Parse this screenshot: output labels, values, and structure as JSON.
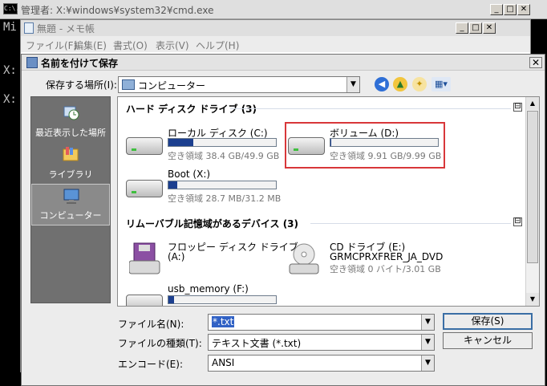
{
  "cmd": {
    "title": "管理者: X:¥windows¥system32¥cmd.exe",
    "icon_text": "C:\\.",
    "prompt_lines": [
      "Mi",
      "X:",
      "X:"
    ]
  },
  "notepad": {
    "title": "無題 - メモ帳",
    "menu": [
      "ファイル(F)",
      "編集(E)",
      "書式(O)",
      "表示(V)",
      "ヘルプ(H)"
    ]
  },
  "dialog": {
    "title": "名前を付けて保存",
    "save_in_label": "保存する場所(I):",
    "save_in_value": "コンピューター",
    "places": [
      {
        "label": "最近表示した場所",
        "icon": "recent-places-icon"
      },
      {
        "label": "ライブラリ",
        "icon": "libraries-icon"
      },
      {
        "label": "コンピューター",
        "icon": "computer-icon"
      }
    ],
    "groups": [
      {
        "header": "ハード ディスク ドライブ (3)"
      },
      {
        "header": "リムーバブル記憶域があるデバイス (3)"
      }
    ],
    "drives": {
      "c": {
        "name": "ローカル ディスク (C:)",
        "free": "空き領域 38.4 GB/49.9 GB",
        "used_fraction": 0.23
      },
      "d": {
        "name": "ボリューム (D:)",
        "free": "空き領域 9.91 GB/9.99 GB",
        "used_fraction": 0.01
      },
      "x": {
        "name": "Boot (X:)",
        "free": "空き領域 28.7 MB/31.2 MB",
        "used_fraction": 0.08
      },
      "a": {
        "name": "フロッピー ディスク ドライブ",
        "sub": "(A:)"
      },
      "e": {
        "name": "CD ドライブ (E:)",
        "sub": "GRMCPRXFRER_JA_DVD",
        "free": "空き領域 0 バイト/3.01 GB"
      },
      "f": {
        "name": "usb_memory (F:)",
        "used_fraction": 0.05
      }
    },
    "filename_label": "ファイル名(N):",
    "filename_value": "*.txt",
    "filetype_label": "ファイルの種類(T):",
    "filetype_value": "テキスト文書 (*.txt)",
    "encoding_label": "エンコード(E):",
    "encoding_value": "ANSI",
    "save_button": "保存(S)",
    "cancel_button": "キャンセル",
    "collapse_symbol": "⊟"
  }
}
